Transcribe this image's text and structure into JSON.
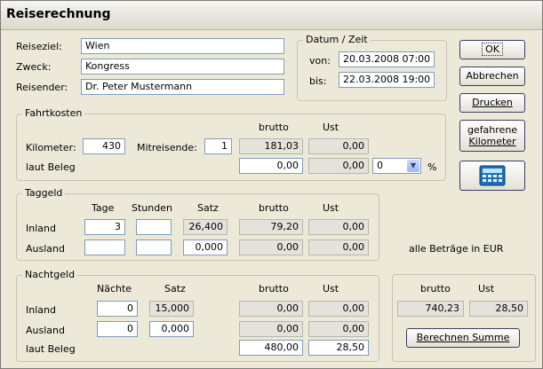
{
  "window": {
    "title": "Reiserechnung"
  },
  "header_fields": {
    "reiseziel_label": "Reiseziel:",
    "reiseziel_value": "Wien",
    "zweck_label": "Zweck:",
    "zweck_value": "Kongress",
    "reisender_label": "Reisender:",
    "reisender_value": "Dr. Peter Mustermann"
  },
  "datum_zeit": {
    "title": "Datum / Zeit",
    "von_label": "von:",
    "von_value": "20.03.2008 07:00",
    "bis_label": "bis:",
    "bis_value": "22.03.2008 19:00"
  },
  "buttons": {
    "ok": "OK",
    "abbrechen": "Abbrechen",
    "drucken": "Drucken",
    "gefahrene_line1": "gefahrene",
    "gefahrene_line2": "Kilometer",
    "berechnen_summe": "Berechnen Summe",
    "calculator_icon": "calculator-icon"
  },
  "fahrtkosten": {
    "title": "Fahrtkosten",
    "brutto_header": "brutto",
    "ust_header": "Ust",
    "kilometer_label": "Kilometer:",
    "kilometer_value": "430",
    "mitreisende_label": "Mitreisende:",
    "mitreisende_value": "1",
    "km_brutto": "181,03",
    "km_ust": "0,00",
    "beleg_label": "laut Beleg",
    "beleg_brutto": "0,00",
    "beleg_ust": "0,00",
    "percent_value": "0",
    "percent_label": "%"
  },
  "taggeld": {
    "title": "Taggeld",
    "tage_header": "Tage",
    "stunden_header": "Stunden",
    "satz_header": "Satz",
    "brutto_header": "brutto",
    "ust_header": "Ust",
    "inland_label": "Inland",
    "inland_tage": "3",
    "inland_stunden": "",
    "inland_satz": "26,400",
    "inland_brutto": "79,20",
    "inland_ust": "0,00",
    "ausland_label": "Ausland",
    "ausland_tage": "",
    "ausland_stunden": "",
    "ausland_satz": "0,000",
    "ausland_brutto": "0,00",
    "ausland_ust": "0,00"
  },
  "currency_note": {
    "text": "alle Beträge in",
    "currency": "EUR"
  },
  "nachtgeld": {
    "title": "Nachtgeld",
    "naechte_header": "Nächte",
    "satz_header": "Satz",
    "brutto_header": "brutto",
    "ust_header": "Ust",
    "inland_label": "Inland",
    "inland_naechte": "0",
    "inland_satz": "15,000",
    "inland_brutto": "0,00",
    "inland_ust": "0,00",
    "ausland_label": "Ausland",
    "ausland_naechte": "0",
    "ausland_satz": "0,000",
    "ausland_brutto": "0,00",
    "ausland_ust": "0,00",
    "beleg_label": "laut Beleg",
    "beleg_brutto": "480,00",
    "beleg_ust": "28,50"
  },
  "summe": {
    "brutto_header": "brutto",
    "ust_header": "Ust",
    "brutto_value": "740,23",
    "ust_value": "28,50"
  }
}
